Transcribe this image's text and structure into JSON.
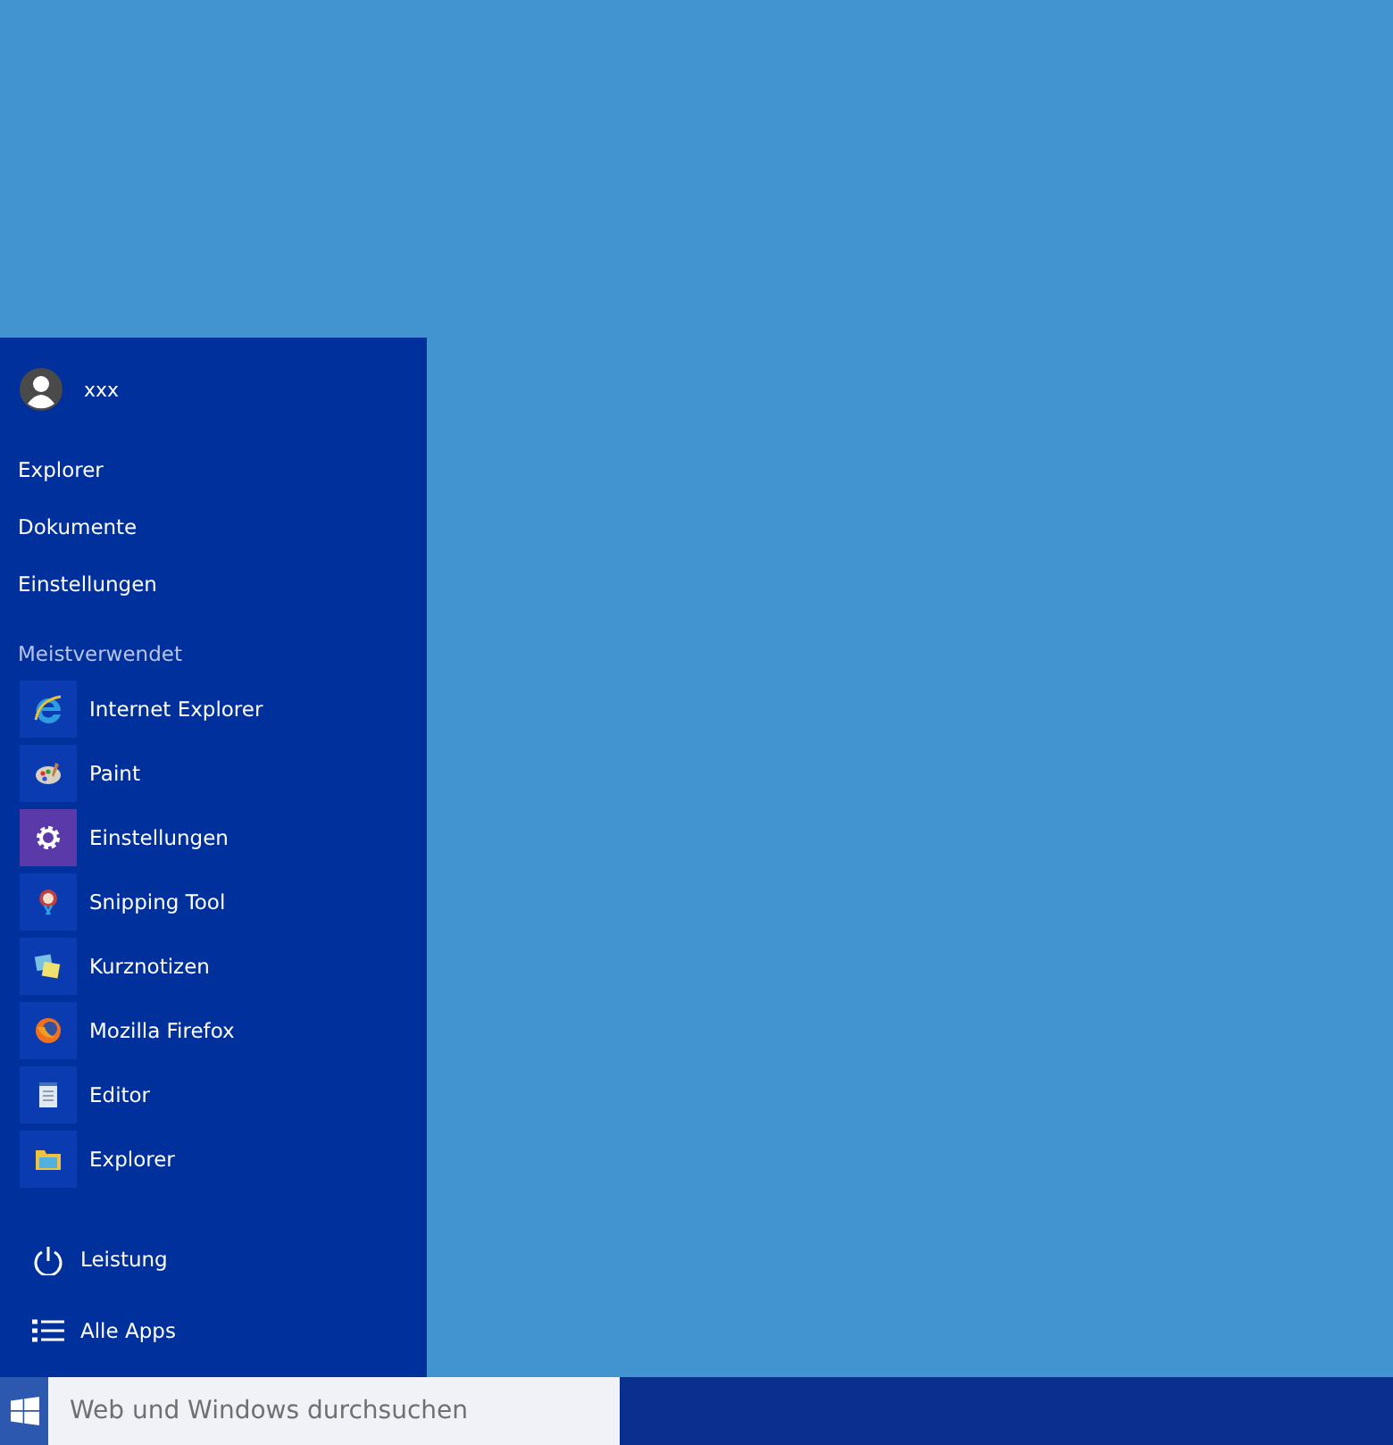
{
  "start_menu": {
    "user": {
      "name": "xxx"
    },
    "places": [
      {
        "label": "Explorer"
      },
      {
        "label": "Dokumente"
      },
      {
        "label": "Einstellungen"
      }
    ],
    "most_used": {
      "heading": "Meistverwendet",
      "apps": [
        {
          "label": "Internet Explorer",
          "kind": "ie",
          "color": "#0a3bb0"
        },
        {
          "label": "Paint",
          "kind": "paint",
          "color": "#0a3bb0"
        },
        {
          "label": "Einstellungen",
          "kind": "settings",
          "color": "#5a3aa8"
        },
        {
          "label": "Snipping Tool",
          "kind": "snip",
          "color": "#0a3bb0"
        },
        {
          "label": "Kurznotizen",
          "kind": "notes",
          "color": "#0a3bb0"
        },
        {
          "label": "Mozilla Firefox",
          "kind": "firefox",
          "color": "#0a3bb0"
        },
        {
          "label": "Editor",
          "kind": "editor",
          "color": "#0a3bb0"
        },
        {
          "label": "Explorer",
          "kind": "folder",
          "color": "#0a3bb0"
        }
      ]
    },
    "bottom": [
      {
        "label": "Leistung",
        "kind": "power"
      },
      {
        "label": "Alle Apps",
        "kind": "list"
      }
    ]
  },
  "taskbar": {
    "search": {
      "placeholder": "Web und Windows durchsuchen"
    }
  }
}
